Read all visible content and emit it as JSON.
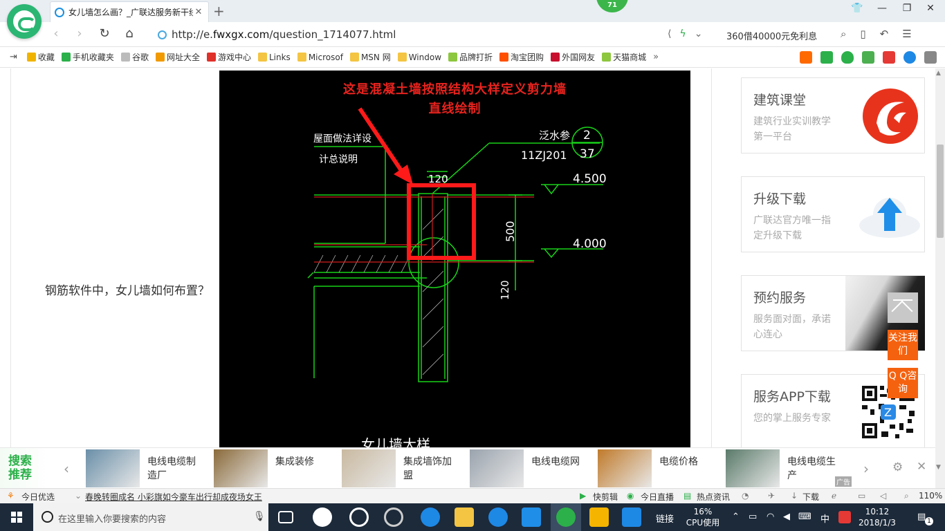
{
  "browser": {
    "tab_title": "女儿墙怎么画？_广联达服务新干线",
    "new_tab": "+",
    "notification_count": "71",
    "url_prefix": "http://e.",
    "url_domain": "fwxgx.com",
    "url_path": "/question_1714077.html",
    "search_box": "360借40000元免利息",
    "bookmarks": [
      {
        "label": "收藏",
        "color": "#f0b400"
      },
      {
        "label": "手机收藏夹",
        "color": "#2cb04a"
      },
      {
        "label": "谷歌",
        "color": "#bbbbbb"
      },
      {
        "label": "网址大全",
        "color": "#f09a00"
      },
      {
        "label": "游戏中心",
        "color": "#e0302a"
      },
      {
        "label": "Links",
        "color": "#f4c542"
      },
      {
        "label": "Microsof",
        "color": "#f4c542"
      },
      {
        "label": "MSN 网",
        "color": "#f4c542"
      },
      {
        "label": "Window",
        "color": "#f4c542"
      },
      {
        "label": "品牌打折",
        "color": "#8dc63f"
      },
      {
        "label": "淘宝团购",
        "color": "#ff5000"
      },
      {
        "label": "外国网友",
        "color": "#c8102e"
      },
      {
        "label": "天猫商城",
        "color": "#8dc63f"
      }
    ],
    "bookmarks_more": "»"
  },
  "page": {
    "question_text": "钢筋软件中，女儿墙如何布置？",
    "cad_caption_line1": "这是混凝土墙按照结构大样定义剪力墙",
    "cad_caption_line2": "直线绘制",
    "cad_labels": {
      "roof_note_1": "屋面做法详设",
      "roof_note_2": "计总说明",
      "waterproof": "泛水参",
      "ref_code": "11ZJ201",
      "ref_num_top": "2",
      "ref_num_bottom": "37",
      "dim_120_top": "120",
      "elev_top": "4.500",
      "dim_500": "500",
      "elev_bottom": "4.000",
      "dim_120_side": "120",
      "bottom_title": "女儿墙大样"
    },
    "side_cards": [
      {
        "title": "建筑课堂",
        "desc": "建筑行业实训教学第一平台"
      },
      {
        "title": "升级下载",
        "desc": "广联达官方唯一指定升级下载"
      },
      {
        "title": "预约服务",
        "desc": "服务面对面，承诺心连心"
      },
      {
        "title": "服务APP下载",
        "desc": "您的掌上服务专家"
      }
    ],
    "float_follow": "关注我们",
    "float_qq": "Q Q咨询"
  },
  "recommend": {
    "label": "搜索推荐",
    "items": [
      {
        "text": "电线电缆制造厂",
        "color": "#6a8fa8"
      },
      {
        "text": "集成装修",
        "color": "#8a6a3a"
      },
      {
        "text": "集成墙饰加盟",
        "color": "#c9b9a0"
      },
      {
        "text": "电线电缆网",
        "color": "#9aa3ad"
      },
      {
        "text": "电缆价格",
        "color": "#c07a2a"
      },
      {
        "text": "电线电缆生产",
        "color": "#5a7a6a"
      }
    ],
    "ad": "广告"
  },
  "status": {
    "today_pick": "今日优选",
    "news": "春晚转圈成名 小彩旗如今豪车出行却成夜场女王",
    "quick_clip": "快剪辑",
    "live": "今日直播",
    "hot_news": "热点资讯",
    "download": "下载",
    "zoom": "110%"
  },
  "taskbar": {
    "search_placeholder": "在这里输入你要搜索的内容",
    "link_label": "链接",
    "cpu_percent": "16%",
    "cpu_label": "CPU使用",
    "ime": "中",
    "time": "10:12",
    "date": "2018/1/3",
    "notif": "1"
  }
}
